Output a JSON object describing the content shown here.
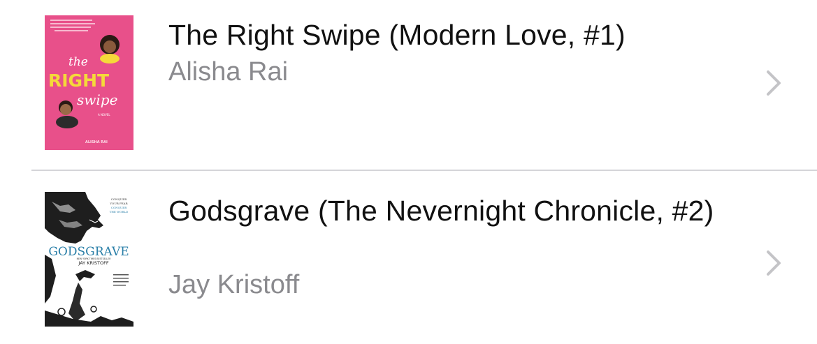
{
  "books": [
    {
      "title": "The Right Swipe (Modern Love, #1)",
      "author": "Alisha Rai",
      "cover": {
        "line_1": "the",
        "line_2": "RIGHT",
        "line_3": "swipe",
        "tag": "A NOVEL",
        "author": "ALISHA RAI",
        "background_color": "#e8508a",
        "accent_color": "#f5d93a"
      }
    },
    {
      "title": "Godsgrave (The Nevernight Chronicle, #2)",
      "author": "Jay Kristoff",
      "cover": {
        "tagline_1": "CONQUER",
        "tagline_2": "YOUR FEAR",
        "tagline_3": "CONQUER",
        "tagline_4": "THE WORLD",
        "title": "GODSGRAVE",
        "bestseller": "NEW YORK TIMES BESTSELLER",
        "author": "JAY KRISTOFF",
        "background_color": "#ffffff",
        "title_color": "#2a7fa8"
      }
    }
  ],
  "icons": {
    "disclosure": "chevron-right-icon"
  },
  "colors": {
    "title_text": "#111111",
    "author_text": "#8a8a8e",
    "chevron": "#c4c4c7",
    "divider": "#d5d5d8"
  }
}
